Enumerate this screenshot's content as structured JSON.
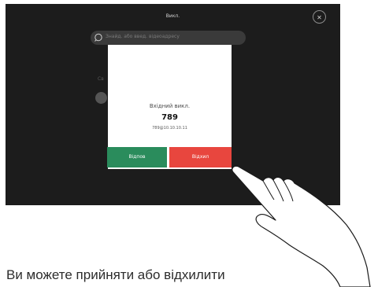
{
  "device": {
    "title": "Викл.",
    "close_icon": "close-icon",
    "search": {
      "icon": "search-icon",
      "placeholder": "Знайд. або введ. відеоадресу"
    }
  },
  "dialog": {
    "incoming_label": "Вхідний викл.",
    "number": "789",
    "address": "789@10.10.10.11",
    "accept_label": "Відпов",
    "decline_label": "Відхил",
    "colors": {
      "accept": "#2a8c5c",
      "decline": "#e8463e"
    }
  },
  "caption": "Ви можете прийняти або відхилити"
}
